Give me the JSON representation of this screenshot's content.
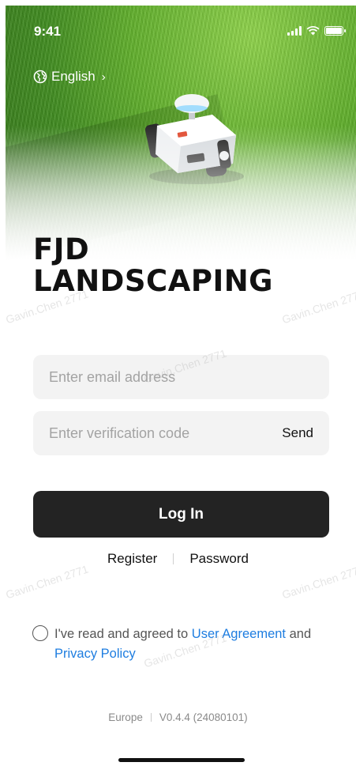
{
  "status_bar": {
    "time": "9:41"
  },
  "language": {
    "label": "English"
  },
  "brand": {
    "line1": "FJD",
    "line2": "LANDSCAPING"
  },
  "form": {
    "email_placeholder": "Enter email address",
    "code_placeholder": "Enter verification code",
    "send_label": "Send",
    "login_label": "Log In"
  },
  "links": {
    "register": "Register",
    "password": "Password"
  },
  "agreement": {
    "prefix": "I've read and agreed to ",
    "user_agreement": "User Agreement",
    "middle": " and",
    "privacy_policy": "Privacy Policy"
  },
  "footer": {
    "region": "Europe",
    "version": "V0.4.4 (24080101)"
  },
  "watermark": "Gavin.Chen 2771",
  "colors": {
    "link": "#1e7de0",
    "button": "#232323",
    "field_bg": "#f3f3f3"
  }
}
